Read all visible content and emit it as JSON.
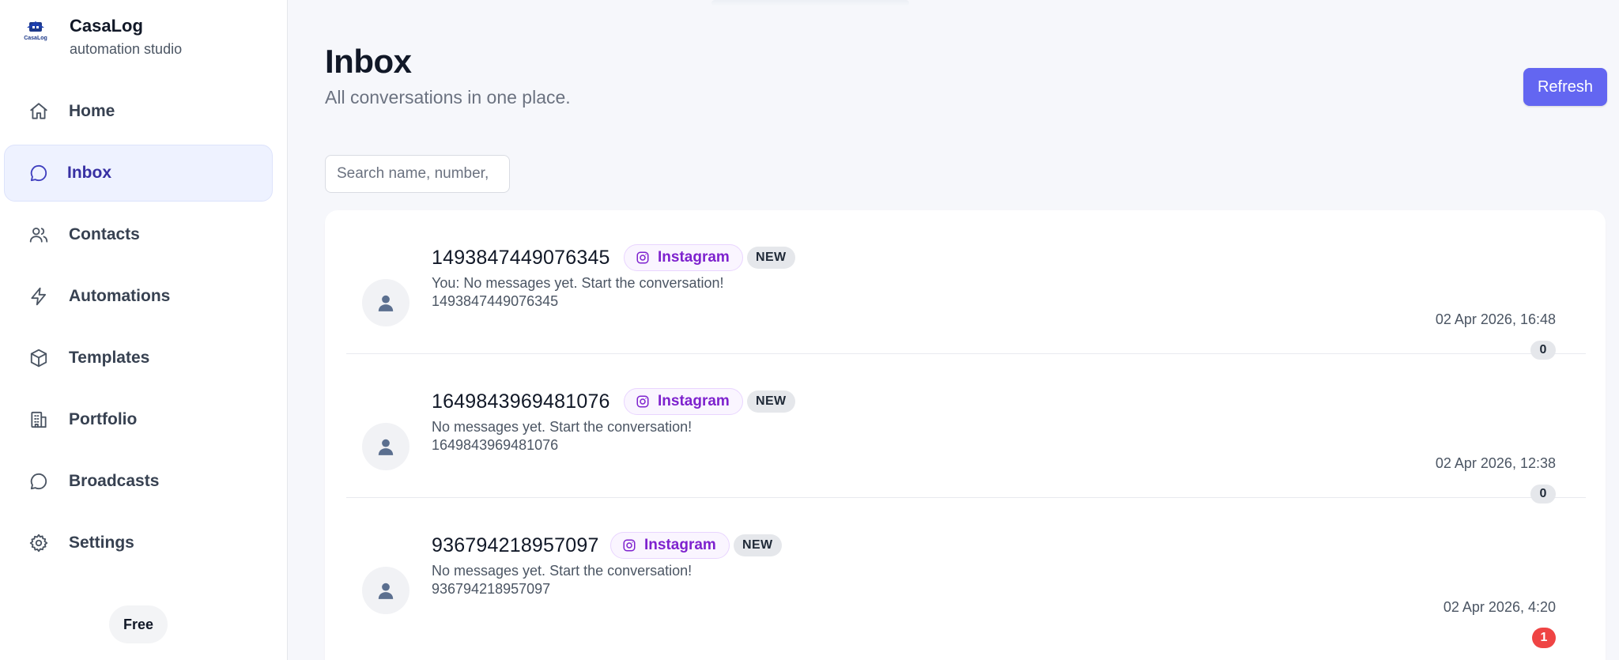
{
  "brand": {
    "logo_text": "CasaLog",
    "name": "CasaLog",
    "subtitle": "automation studio"
  },
  "nav": {
    "items": [
      {
        "label": "Home",
        "icon": "home-icon"
      },
      {
        "label": "Inbox",
        "icon": "chat-bubble-icon",
        "active": true
      },
      {
        "label": "Contacts",
        "icon": "users-icon"
      },
      {
        "label": "Automations",
        "icon": "lightning-icon"
      },
      {
        "label": "Templates",
        "icon": "box-icon"
      },
      {
        "label": "Portfolio",
        "icon": "building-icon"
      },
      {
        "label": "Broadcasts",
        "icon": "chat-bubble-icon"
      },
      {
        "label": "Settings",
        "icon": "gear-icon"
      }
    ],
    "plan": "Free"
  },
  "header": {
    "title": "Inbox",
    "subtitle": "All conversations in one place.",
    "refresh_label": "Refresh"
  },
  "search": {
    "placeholder": "Search name, number, "
  },
  "conversations": [
    {
      "name": "1493847449076345",
      "channel": "Instagram",
      "status": "NEW",
      "preview": "You: No messages yet. Start the conversation!",
      "handle": "1493847449076345",
      "time": "02 Apr 2026, 16:48",
      "count": "0"
    },
    {
      "name": "1649843969481076",
      "channel": "Instagram",
      "status": "NEW",
      "preview": "No messages yet. Start the conversation!",
      "handle": "1649843969481076",
      "time": "02 Apr 2026, 12:38",
      "count": "0"
    },
    {
      "name": "936794218957097",
      "channel": "Instagram",
      "status": "NEW",
      "preview": "No messages yet. Start the conversation!",
      "handle": "936794218957097",
      "time": "02 Apr 2026, 4:20",
      "count": "1"
    }
  ],
  "colors": {
    "accent": "#6366f1",
    "active_nav_bg": "#eef2ff",
    "instagram_purple": "#7e22ce",
    "unread_red": "#ef4444"
  }
}
